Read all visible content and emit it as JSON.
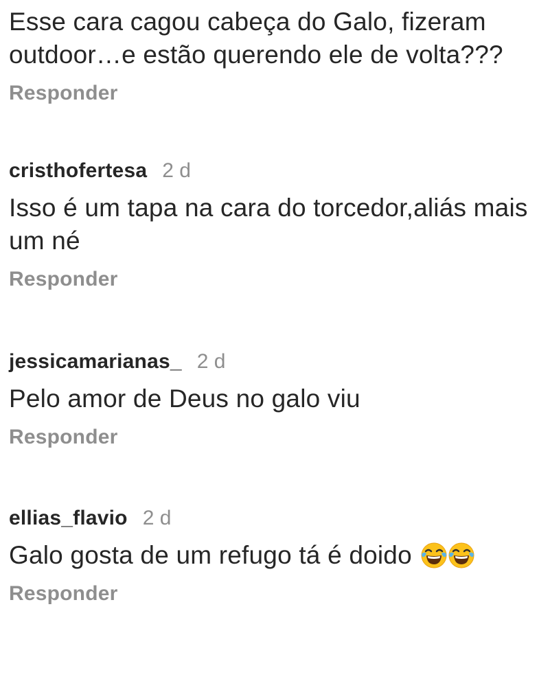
{
  "reply_label": "Responder",
  "comments": [
    {
      "text": "Esse cara cagou cabeça do Galo, fizeram outdoor…e estão querendo ele de volta???"
    },
    {
      "username": "cristhofertesa",
      "time": "2 d",
      "text": "Isso é um tapa na cara do torcedor,aliás mais um né"
    },
    {
      "username": "jessicamarianas_",
      "time": "2 d",
      "text": "Pelo amor de Deus no galo viu"
    },
    {
      "username": "ellias_flavio",
      "time": "2 d",
      "text": "Galo gosta de um refugo tá é doido",
      "emojis": [
        "face-with-tears-of-joy-icon",
        "face-with-tears-of-joy-icon"
      ]
    }
  ]
}
